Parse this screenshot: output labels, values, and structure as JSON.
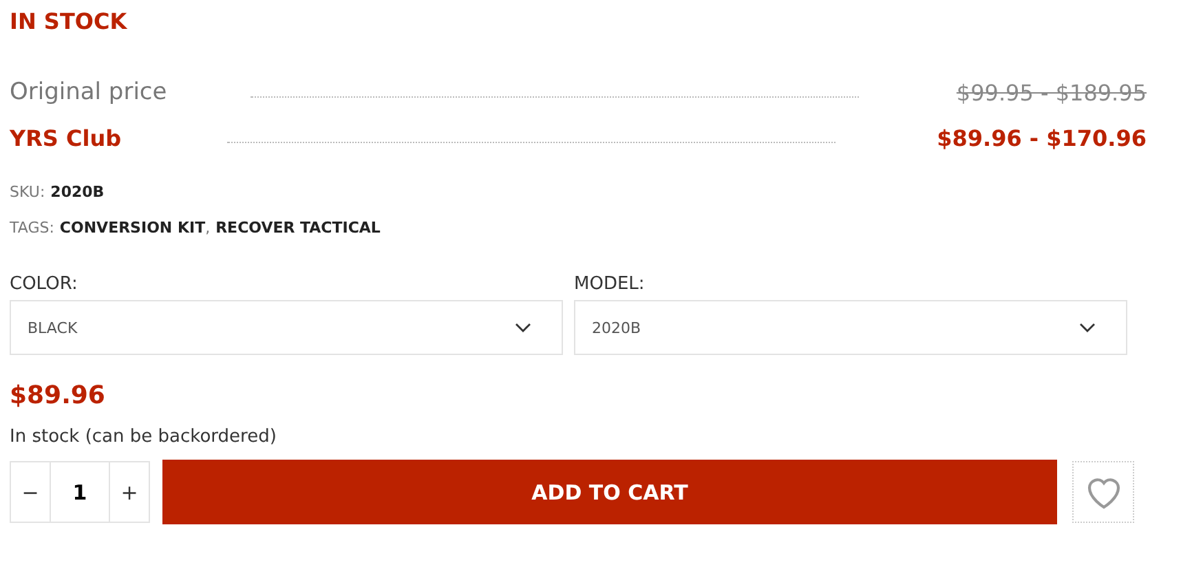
{
  "stock_status": "IN STOCK",
  "prices": [
    {
      "kind": "original",
      "label": "Original price",
      "value": "$99.95 - $189.95"
    },
    {
      "kind": "club",
      "label": "YRS Club",
      "value": "$89.96 - $170.96"
    }
  ],
  "sku": {
    "label": "SKU:",
    "value": "2020B"
  },
  "tags": {
    "label": "TAGS:",
    "separator": ",",
    "items": [
      "CONVERSION KIT",
      "RECOVER TACTICAL"
    ]
  },
  "options": [
    {
      "label": "COLOR:",
      "value": "BLACK"
    },
    {
      "label": "MODEL:",
      "value": "2020B"
    }
  ],
  "price": "$89.96",
  "availability": "In stock (can be backordered)",
  "quantity": {
    "minus": "−",
    "value": "1",
    "plus": "+"
  },
  "add_to_cart": "ADD TO CART"
}
